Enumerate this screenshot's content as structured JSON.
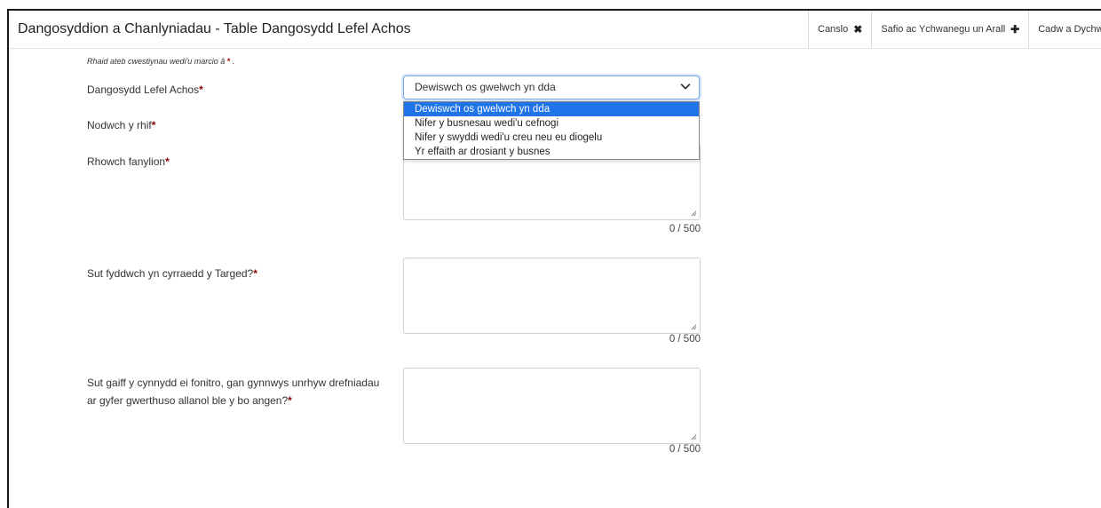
{
  "header": {
    "title": "Dangosyddion a Chanlyniadau - Table Dangosydd Lefel Achos",
    "actions": [
      {
        "label": "Canslo",
        "icon": "close-icon",
        "glyph": "✖"
      },
      {
        "label": "Safio ac Ychwanegu un Arall",
        "icon": "plus-icon",
        "glyph": "✚"
      },
      {
        "label": "Cadw a Dychwelyd",
        "icon": "arrow-icon",
        "glyph": ""
      }
    ]
  },
  "form": {
    "required_note": "Rhaid ateb cwestiynau wedi'u marcio â",
    "required_marker": "*",
    "required_note_end": ".",
    "indicator": {
      "label": "Dangosydd Lefel Achos",
      "selected": "Dewiswch os gwelwch yn dda",
      "options": [
        "Dewiswch os gwelwch yn dda",
        "Nifer y busnesau wedi'u cefnogi",
        "Nifer y swyddi wedi'u creu neu eu diogelu",
        "Yr effaith ar drosiant y busnes"
      ]
    },
    "number_label": "Nodwch y rhif",
    "details": {
      "label": "Rhowch fanylion",
      "counter": "0 / 500"
    },
    "target": {
      "label": "Sut fyddwch yn cyrraedd y Targed?",
      "counter": "0 / 500"
    },
    "monitoring": {
      "label_line1": "Sut gaiff y cynnydd ei fonitro, gan gynnwys unrhyw drefniadau",
      "label_line2": "ar gyfer gwerthuso allanol ble y bo angen?",
      "counter": "0 / 500"
    },
    "asterisk": "*"
  },
  "colors": {
    "required": "#8b0000",
    "selected_option": "#1e74e8"
  }
}
